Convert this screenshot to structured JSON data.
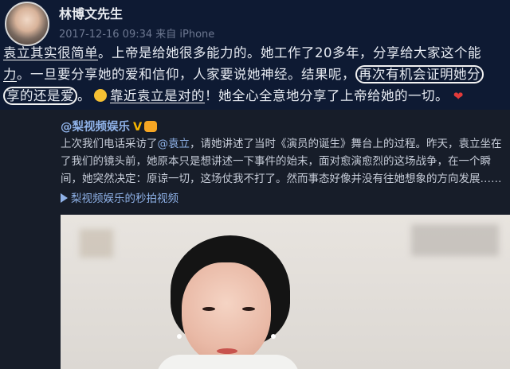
{
  "post": {
    "author": "林博文先生",
    "meta": "2017-12-16 09:34 来自 iPhone",
    "line1_a": "袁立其实很简单",
    "line1_b": "。上帝是给她很多能力的。她工作了20多年，分享给大家这个能",
    "line2_a": "力",
    "line2_b": "。一旦要分享她的爱和信仰，人家要说她神经。结果呢，",
    "line2_c": "再次有机会证明她分",
    "line3_a": "享的还是爱",
    "line3_b": "。",
    "line3_c": "靠近袁立是对的",
    "line3_d": "！她全心全意地分享了上帝给她的一切。",
    "heart": "❤"
  },
  "repost": {
    "source": "@梨视频娱乐",
    "verified": "V",
    "text_a": "上次我们电话采访了",
    "mention": "@袁立",
    "text_b": "，请她讲述了当时《演员的诞生》舞台上的过程。昨天，袁立坐在了我们的镜头前，她原本只是想讲述一下事件的始末，面对愈演愈烈的这场战争，在一个瞬间，她突然决定：原谅一切，这场仗我不打了。然而事态好像并没有往她想象的方向发展……",
    "video_link": "梨视频娱乐的秒拍视频"
  },
  "colors": {
    "post_bg": "#0e1a33",
    "repost_bg": "#171d29",
    "link": "#8fb2e8",
    "heart": "#e23a3a"
  }
}
